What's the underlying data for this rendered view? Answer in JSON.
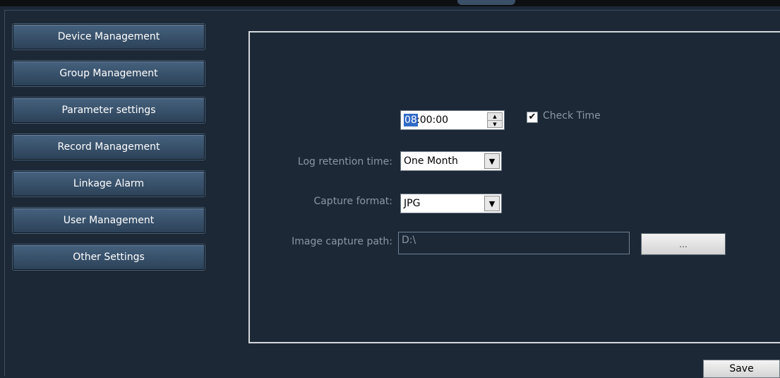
{
  "nav": {
    "items": [
      {
        "label": "Device Management"
      },
      {
        "label": "Group Management"
      },
      {
        "label": "Parameter settings"
      },
      {
        "label": "Record Management"
      },
      {
        "label": "Linkage Alarm"
      },
      {
        "label": "User Management"
      },
      {
        "label": "Other Settings"
      }
    ]
  },
  "settings": {
    "check_time": {
      "hour_selected": "08",
      "rest": ":00:00",
      "checked": true,
      "checkbox_mark": "✔",
      "label": "Check Time"
    },
    "log_retention": {
      "label": "Log retention time:",
      "value": "One Month"
    },
    "capture_format": {
      "label": "Capture format:",
      "value": "JPG"
    },
    "capture_path": {
      "label": "Image capture path:",
      "value": "D:\\",
      "browse_label": "..."
    }
  },
  "footer": {
    "save_label": "Save"
  },
  "icons": {
    "spin_up": "▲",
    "spin_down": "▼",
    "dropdown": "▼"
  }
}
